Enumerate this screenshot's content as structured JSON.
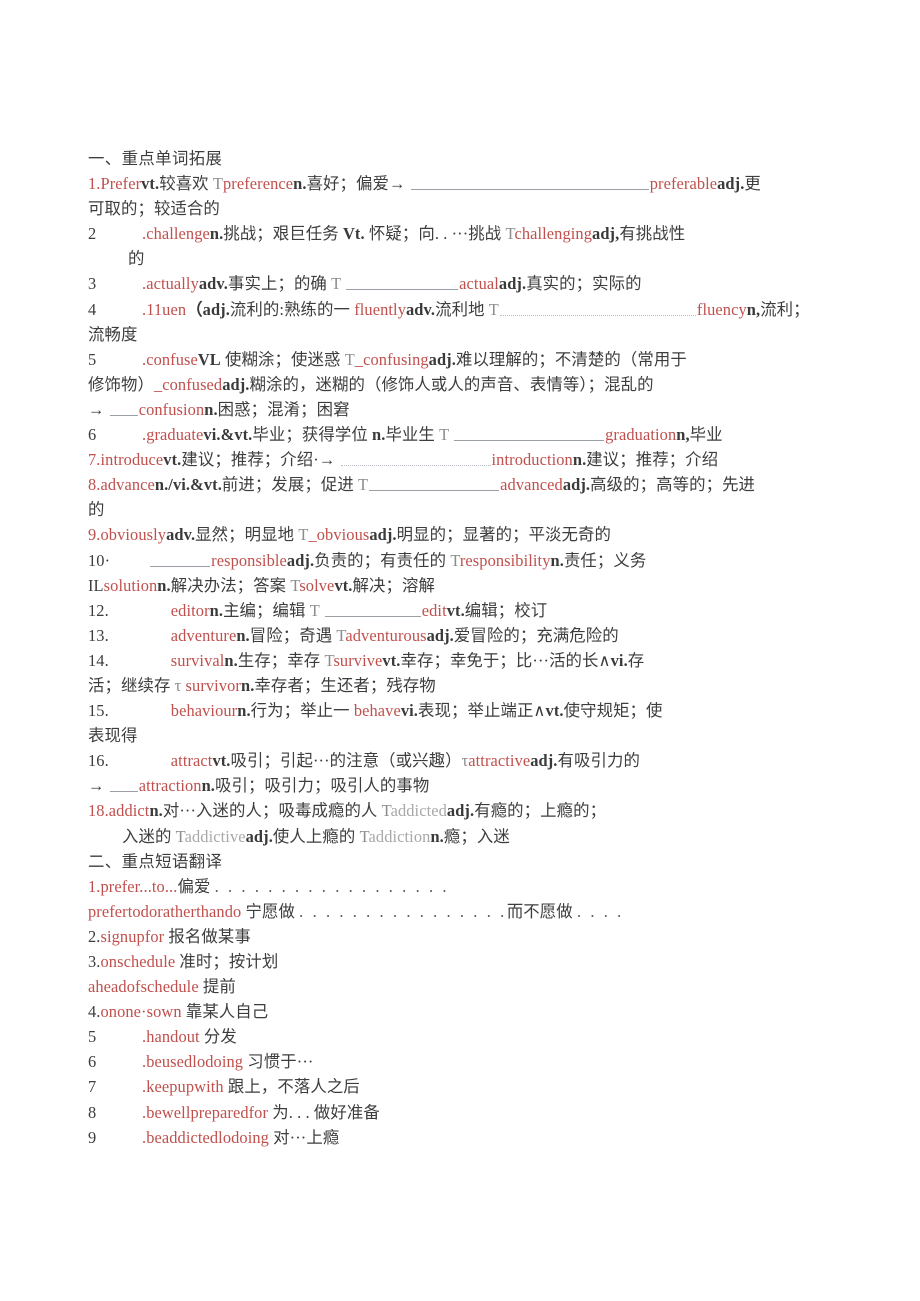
{
  "document": {
    "title": "英语重点单词拓展与短语翻译讲义",
    "sections": [
      {
        "heading": "一、重点单词拓展",
        "entries": [
          {
            "number": "1.",
            "word": "Prefer",
            "pos": "vt.",
            "line1_pre": "较喜欢 T",
            "derived1": "preference",
            "derived1_pos": "n.",
            "derived1_def": "喜好；偏爱→",
            "blank_answer": "preferable",
            "blank_answer_pos": "adj.",
            "tail": "更可取的；较适合的",
            "full_line_1": "1.Prefervt.较喜欢 Tpreferencen.喜好；偏爱→",
            "full_line_1b": "preferableadj.更",
            "full_line_2": "可取的；较适合的"
          },
          {
            "number": "2",
            "full_line_1": ".challengen.挑战；艰巨任务 Vt. 怀疑；向. . ···挑战 Tchallengingadj,有挑战性",
            "full_line_2": "的"
          },
          {
            "number": "3",
            "full_line_1": ".actuallyadv.事实上；的确 T",
            "full_line_1b": "actualadj.真实的；实际的"
          },
          {
            "number": "4",
            "full_line_1": ".11uen（adj.流利的:熟练的一 fluentlyadv.流利地 T",
            "full_line_1b": "fluencyn,流利；",
            "full_line_2": "流畅度"
          },
          {
            "number": "5",
            "full_line_1": ".confuseVL 使糊涂；使迷惑 T_confusingadj.难以理解的；不清楚的（常用于",
            "full_line_2": "修饰物）_confusedadj.糊涂的，迷糊的（修饰人或人的声音、表情等）；混乱的",
            "full_line_3": "→___confusionn.困惑；混淆；困窘"
          },
          {
            "number": "6",
            "full_line_1": ".graduatevi.&vt.毕业；获得学位 n.毕业生 T",
            "full_line_1b": "graduationn,毕业"
          },
          {
            "number": "7.",
            "full_line_1": "7.introducevt.建议；推荐；介绍·→",
            "full_line_1b": "introductionn.建议；推荐；介绍"
          },
          {
            "number": "8.",
            "full_line_1": "8.advancen./vi.&vt.前进；发展；促进 T",
            "full_line_1b": "advancedadj.高级的；高等的；先进",
            "full_line_2": "的"
          },
          {
            "number": "9.",
            "full_line_1": "9.obviouslyadv.显然；明显地 T_obviousadj.明显的；显著的；平淡无奇的"
          },
          {
            "number": "10·",
            "full_line_1": "responsibleadj.负责的；有责任的 Tresponsibilityn.责任；义务"
          },
          {
            "number": "IL",
            "full_line_1": "ILsolutionn.解决办法；答案 Tsolvevt.解决；溶解"
          },
          {
            "number": "12.",
            "full_line_1": "editorn.主编；编辑 T",
            "full_line_1b": "editvt.编辑；校订"
          },
          {
            "number": "13.",
            "full_line_1": "adventuren.冒险；奇遇 Tadventurousadj.爱冒险的；充满危险的"
          },
          {
            "number": "14.",
            "full_line_1": "survivaln.生存；幸存 Tsurvivevt.幸存；幸免于；比···活的长∧vi.存",
            "full_line_2": "活；继续存 τ survivorn.幸存者；生还者；残存物"
          },
          {
            "number": "15.",
            "full_line_1": "behaviourn.行为；举止一 behavevi.表现；举止端正∧vt.使守规矩；使",
            "full_line_2": "表现得"
          },
          {
            "number": "16.",
            "full_line_1": "attractvt.吸引；引起···的注意（或兴趣）τattractiveadj.有吸引力的",
            "full_line_2": "→___attractionn.吸引；吸引力；吸引人的事物"
          },
          {
            "number": "18.",
            "full_line_1": "18.addictn.对···入迷的人；吸毒成瘾的人 Taddictedadj.有瘾的；上瘾的；",
            "full_line_2": "入迷的 Taddictiveadj.使人上瘾的 Taddictionn.瘾；入迷"
          }
        ]
      },
      {
        "heading": "二、重点短语翻译",
        "phrases": [
          {
            "number": "1.",
            "en": "prefer...to...",
            "zh": "偏爱",
            "dots": ". . . . . . . . . . . . . . . . . ."
          },
          {
            "number": "",
            "en": "prefertodoratherthando",
            "zh": "宁愿做",
            "dots": ". . . . . . . . . . . . . . . .",
            "zh2": "而不愿做",
            "dots2": ". . . ."
          },
          {
            "number": "2.",
            "en": "signupfor",
            "zh": "报名做某事"
          },
          {
            "number": "3.",
            "en": "onschedule",
            "zh": "准时；按计划"
          },
          {
            "number": "",
            "en": "aheadofschedule",
            "zh": "提前"
          },
          {
            "number": "4.",
            "en": "onone·sown",
            "zh": "靠某人自己"
          },
          {
            "number": "5",
            "en": ".handout",
            "zh": "分发"
          },
          {
            "number": "6",
            "en": ".beusedlodoing",
            "zh": "习惯于···"
          },
          {
            "number": "7",
            "en": ".keepupwith",
            "zh": "跟上，不落人之后"
          },
          {
            "number": "8",
            "en": ".bewellpreparedfor",
            "zh": "为. . . 做好准备"
          },
          {
            "number": "9",
            "en": ".beaddictedlodoing",
            "zh": "对···上瘾"
          }
        ]
      }
    ]
  },
  "colors": {
    "lemma_red": "#c0504d",
    "body_text": "#3d3d3d",
    "blank_rule": "#9aa0a6",
    "page_background": "#ffffff"
  }
}
